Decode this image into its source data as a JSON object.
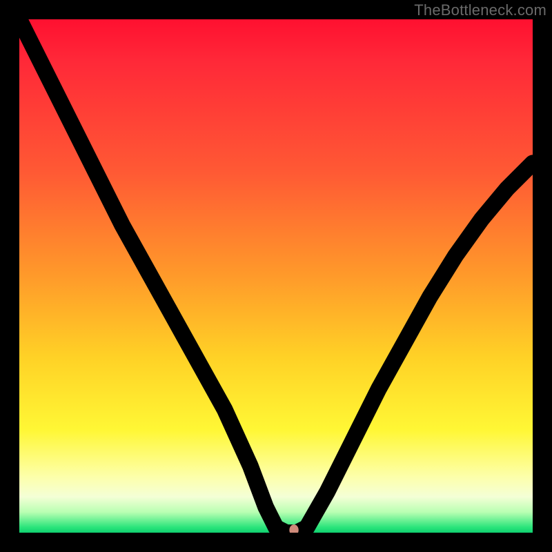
{
  "watermark": "TheBottleneck.com",
  "chart_data": {
    "type": "line",
    "title": "",
    "xlabel": "",
    "ylabel": "",
    "xlim": [
      0,
      100
    ],
    "ylim": [
      0,
      100
    ],
    "grid": false,
    "legend": false,
    "series": [
      {
        "name": "curve",
        "x": [
          0,
          5,
          10,
          15,
          20,
          25,
          30,
          35,
          40,
          45,
          48,
          50,
          52,
          54,
          56,
          60,
          65,
          70,
          75,
          80,
          85,
          90,
          95,
          100
        ],
        "y": [
          100,
          90,
          80,
          70,
          60,
          51,
          42,
          33,
          24,
          13,
          5,
          1,
          0,
          0,
          1,
          8,
          18,
          28,
          37,
          46,
          54,
          61,
          67,
          72
        ]
      }
    ],
    "marker": {
      "x": 53.5,
      "y": 0.5,
      "color": "#cf8a7a"
    },
    "background_gradient": {
      "direction": "vertical",
      "stops": [
        {
          "pos": 0.0,
          "color": "#ff1030"
        },
        {
          "pos": 0.3,
          "color": "#ff5a34"
        },
        {
          "pos": 0.5,
          "color": "#ff9a2a"
        },
        {
          "pos": 0.8,
          "color": "#fff735"
        },
        {
          "pos": 0.93,
          "color": "#f4ffd6"
        },
        {
          "pos": 1.0,
          "color": "#10d070"
        }
      ]
    }
  }
}
